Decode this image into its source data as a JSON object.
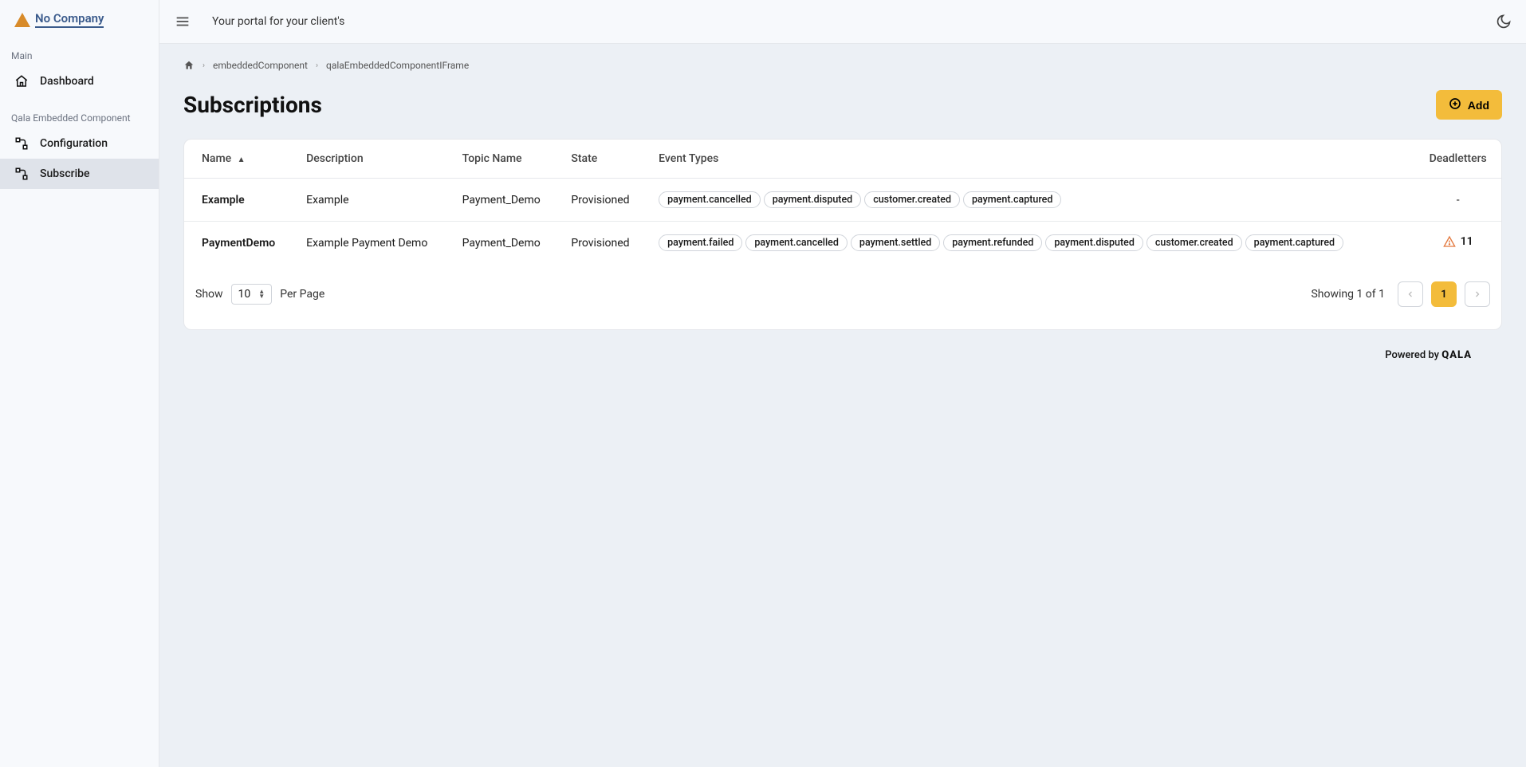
{
  "logo": {
    "text": "No Company"
  },
  "sidebar": {
    "sections": [
      {
        "label": "Main",
        "items": [
          {
            "label": "Dashboard",
            "icon": "home"
          }
        ]
      },
      {
        "label": "Qala Embedded Component",
        "items": [
          {
            "label": "Configuration",
            "icon": "workflow"
          },
          {
            "label": "Subscribe",
            "icon": "workflow"
          }
        ]
      }
    ]
  },
  "topbar": {
    "title": "Your portal for your client's"
  },
  "breadcrumb": {
    "items": [
      "embeddedComponent",
      "qalaEmbeddedComponentIFrame"
    ]
  },
  "page": {
    "title": "Subscriptions",
    "add_label": "Add"
  },
  "table": {
    "columns": [
      "Name",
      "Description",
      "Topic Name",
      "State",
      "Event Types",
      "Deadletters"
    ],
    "rows": [
      {
        "name": "Example",
        "description": "Example",
        "topic": "Payment_Demo",
        "state": "Provisioned",
        "eventTypes": [
          "payment.cancelled",
          "payment.disputed",
          "customer.created",
          "payment.captured"
        ],
        "deadletters": "-"
      },
      {
        "name": "PaymentDemo",
        "description": "Example Payment Demo",
        "topic": "Payment_Demo",
        "state": "Provisioned",
        "eventTypes": [
          "payment.failed",
          "payment.cancelled",
          "payment.settled",
          "payment.refunded",
          "payment.disputed",
          "customer.created",
          "payment.captured"
        ],
        "deadletters": "11",
        "warning": true
      }
    ]
  },
  "pagination": {
    "show_label": "Show",
    "per_page_label": "Per Page",
    "page_size": "10",
    "info": "Showing 1 of 1",
    "current": "1"
  },
  "footer": {
    "powered": "Powered by",
    "brand": "QALA"
  }
}
